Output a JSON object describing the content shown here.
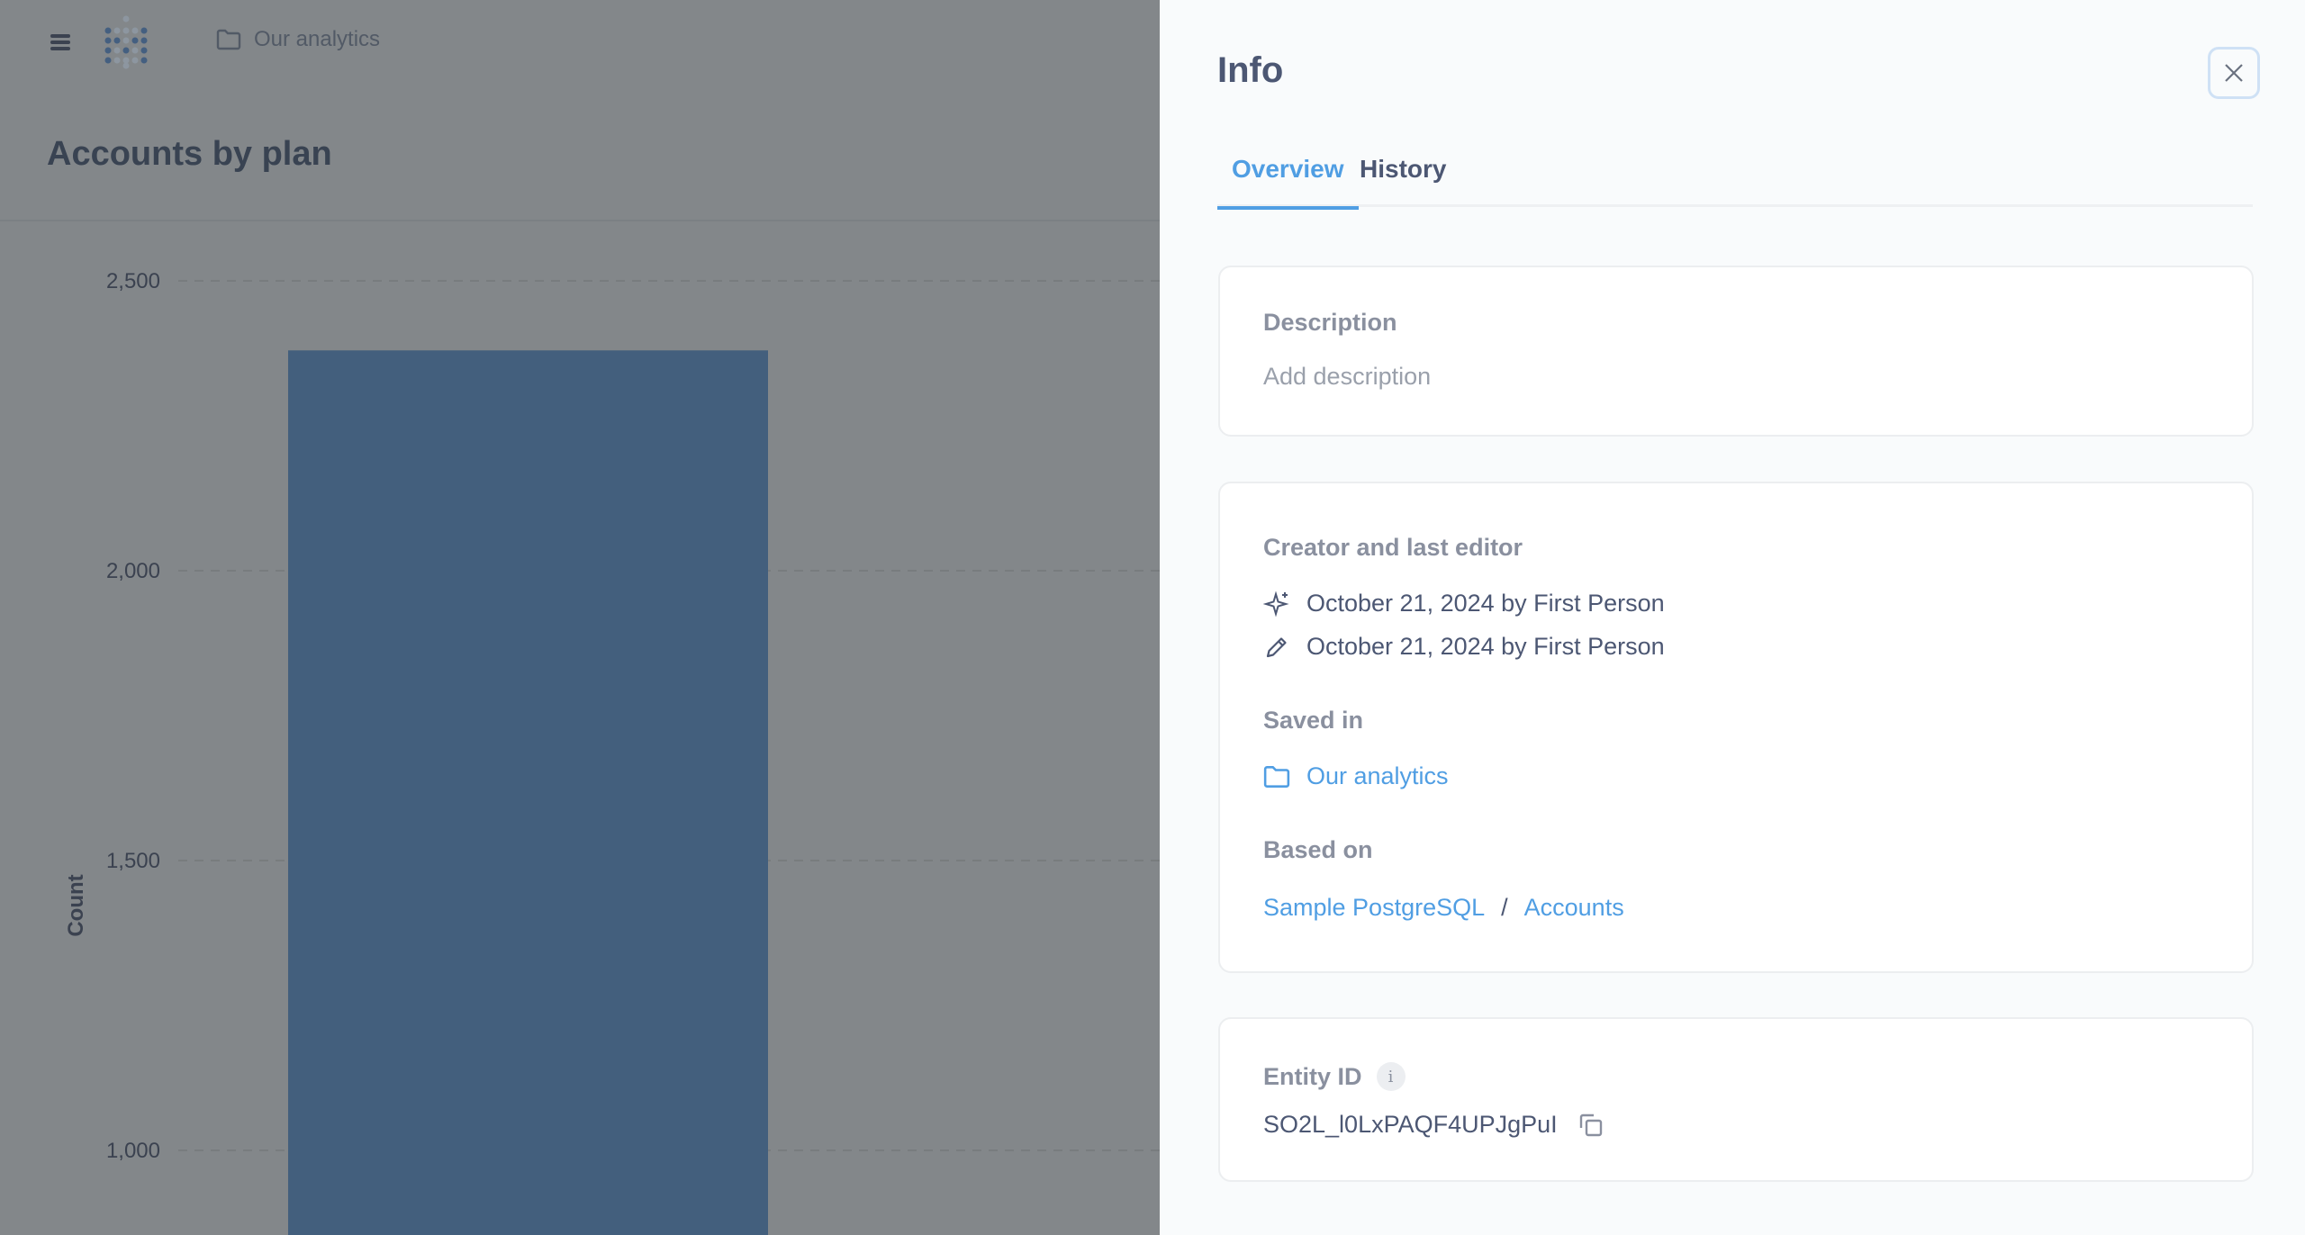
{
  "topbar": {
    "breadcrumb": "Our analytics",
    "menu_icon": "hamburger-icon",
    "logo": "metabase-logo"
  },
  "page": {
    "title": "Accounts by plan"
  },
  "chart_data": {
    "type": "bar",
    "ylabel": "Count",
    "ylim": [
      1000,
      2500
    ],
    "y_ticks": [
      "2,500",
      "2,000",
      "1,500",
      "1,000"
    ],
    "y_tick_values": [
      2500,
      2000,
      1500,
      1000
    ],
    "values": [
      2380
    ],
    "grid": true,
    "bar_color": "#435f7d"
  },
  "panel": {
    "title": "Info",
    "close_icon": "close-icon",
    "tabs": [
      {
        "label": "Overview",
        "active": true
      },
      {
        "label": "History",
        "active": false
      }
    ],
    "description": {
      "label": "Description",
      "placeholder": "Add description"
    },
    "creator": {
      "label": "Creator and last editor",
      "created": "October 21, 2024 by First Person",
      "edited": "October 21, 2024 by First Person"
    },
    "saved_in": {
      "label": "Saved in",
      "collection": "Our analytics"
    },
    "based_on": {
      "label": "Based on",
      "database": "Sample PostgreSQL",
      "separator": "/",
      "table": "Accounts"
    },
    "entity": {
      "label": "Entity ID",
      "info_glyph": "i",
      "id": "SO2L_l0LxPAQF4UPJgPuI"
    },
    "accent": "#509ee3"
  }
}
